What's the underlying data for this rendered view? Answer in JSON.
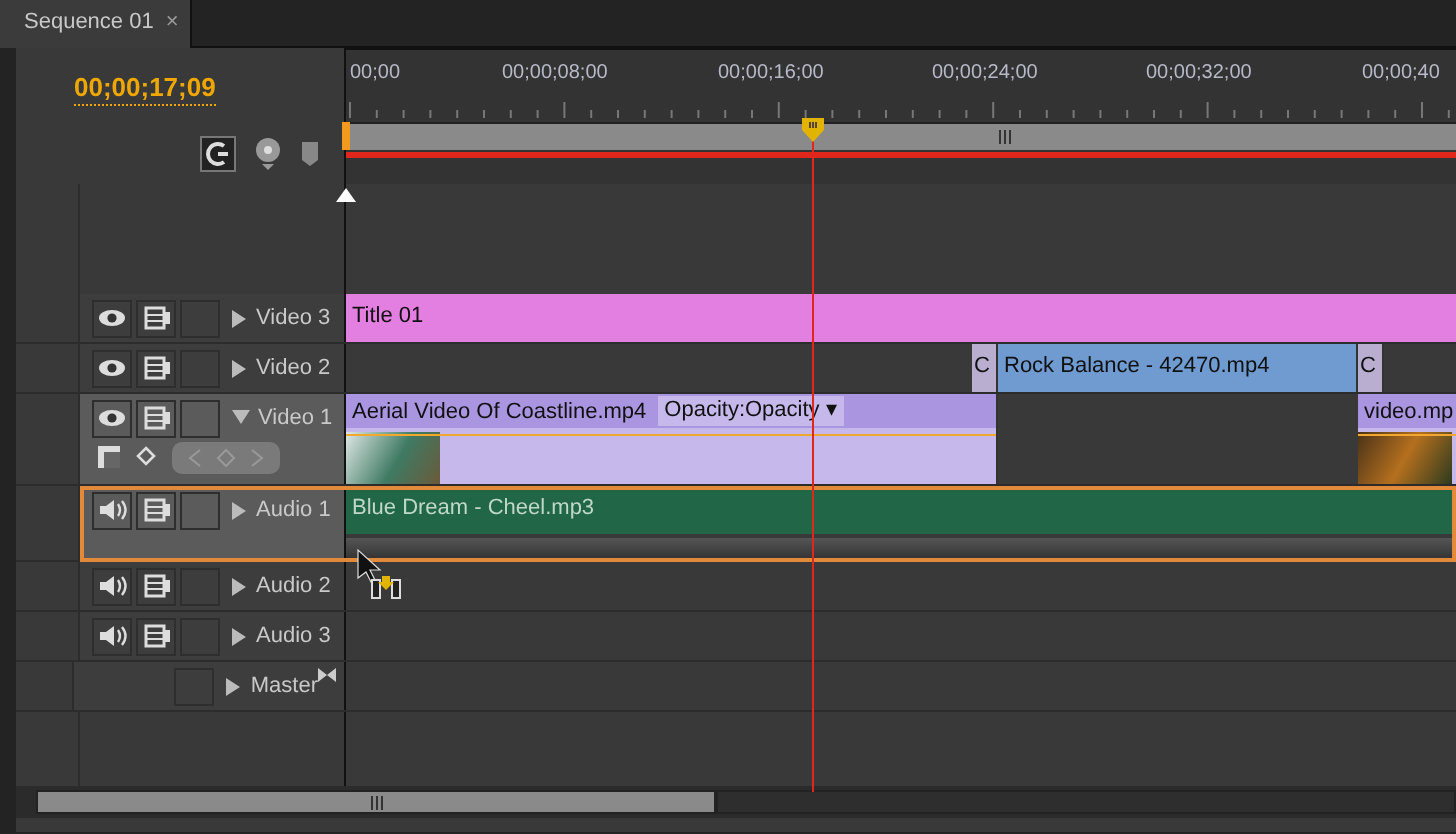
{
  "tab": {
    "title": "Sequence 01",
    "close": "×"
  },
  "timecode": "00;00;17;09",
  "ruler": {
    "labels": [
      "00;00",
      "00;00;08;00",
      "00;00;16;00",
      "00;00;24;00",
      "00;00;32;00",
      "00;00;40"
    ]
  },
  "tracks": [
    {
      "kind": "video",
      "name": "Video 3",
      "expanded": false,
      "targeted": false,
      "selected": false,
      "clips": [
        {
          "kind": "title",
          "label": "Title 01"
        }
      ]
    },
    {
      "kind": "video",
      "name": "Video 2",
      "expanded": false,
      "targeted": false,
      "selected": false,
      "clips": [
        {
          "kind": "transition",
          "label": "C"
        },
        {
          "kind": "video",
          "label": "Rock Balance - 42470.mp4"
        },
        {
          "kind": "transition",
          "label": "C"
        }
      ]
    },
    {
      "kind": "video",
      "name": "Video 1",
      "expanded": true,
      "targeted": true,
      "selected": false,
      "clips": [
        {
          "kind": "video",
          "label": "Aerial Video Of Coastline.mp4",
          "effect": "Opacity:Opacity ▾"
        },
        {
          "kind": "video",
          "label": "video.mp"
        }
      ]
    },
    {
      "kind": "audio",
      "name": "Audio 1",
      "expanded": false,
      "targeted": true,
      "selected": true,
      "clips": [
        {
          "kind": "audio",
          "label": "Blue Dream - Cheel.mp3"
        }
      ]
    },
    {
      "kind": "audio",
      "name": "Audio 2",
      "expanded": false,
      "targeted": false,
      "selected": false
    },
    {
      "kind": "audio",
      "name": "Audio 3",
      "expanded": false,
      "targeted": false,
      "selected": false
    },
    {
      "kind": "master",
      "name": "Master",
      "expanded": false,
      "targeted": false,
      "selected": false
    }
  ]
}
